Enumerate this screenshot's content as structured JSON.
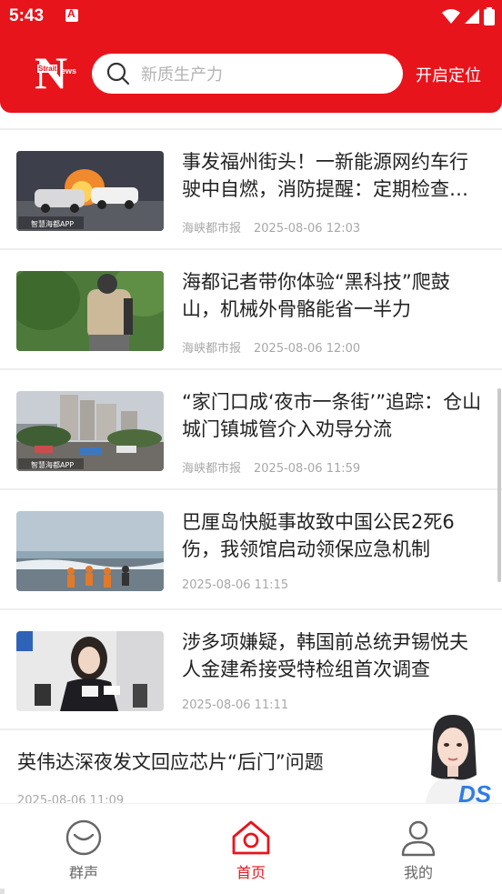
{
  "status_bar": {
    "time": "5:43"
  },
  "header": {
    "logo_letter": "N",
    "logo_small_top": "Strait",
    "logo_small_right": "ews",
    "search_placeholder": "新质生产力",
    "locate_label": "开启定位",
    "accent_color": "#e8141c"
  },
  "news": [
    {
      "title": "事发福州街头！一新能源网约车行驶中自燃，消防提醒：定期检查车辆",
      "source": "海峡都市报",
      "time": "2025-08-06 12:03",
      "thumb_watermark": "智慧海都APP",
      "thumb": "car-fire-photo"
    },
    {
      "title": "海都记者带你体验“黑科技”爬鼓山，机械外骨骼能省一半力",
      "source": "海峡都市报",
      "time": "2025-08-06 12:00",
      "thumb_watermark": "",
      "thumb": "exoskeleton-hiker-photo"
    },
    {
      "title": "“家门口成‘夜市一条街’”追踪：仓山城门镇城管介入劝导分流",
      "source": "海峡都市报",
      "time": "2025-08-06 11:59",
      "thumb_watermark": "智慧海都APP",
      "thumb": "street-market-photo"
    },
    {
      "title": "巴厘岛快艇事故致中国公民2死6伤，我领馆启动领保应急机制",
      "source": "",
      "time": "2025-08-06 11:15",
      "thumb_watermark": "",
      "thumb": "beach-rescue-photo"
    },
    {
      "title": "涉多项嫌疑，韩国前总统尹锡悦夫人金建希接受特检组首次调查",
      "source": "",
      "time": "2025-08-06 11:11",
      "thumb_watermark": "",
      "thumb": "press-interview-photo"
    }
  ],
  "text_news": {
    "title": "英伟达深夜发文回应芯片“后门”问题",
    "time": "2025-08-06 11:09"
  },
  "assistant": {
    "badge": "DS",
    "icon": "assistant-avatar"
  },
  "bottom_nav": [
    {
      "label": "群声",
      "icon": "chat-face-icon",
      "active": false
    },
    {
      "label": "首页",
      "icon": "home-icon",
      "active": true
    },
    {
      "label": "我的",
      "icon": "user-icon",
      "active": false
    }
  ]
}
